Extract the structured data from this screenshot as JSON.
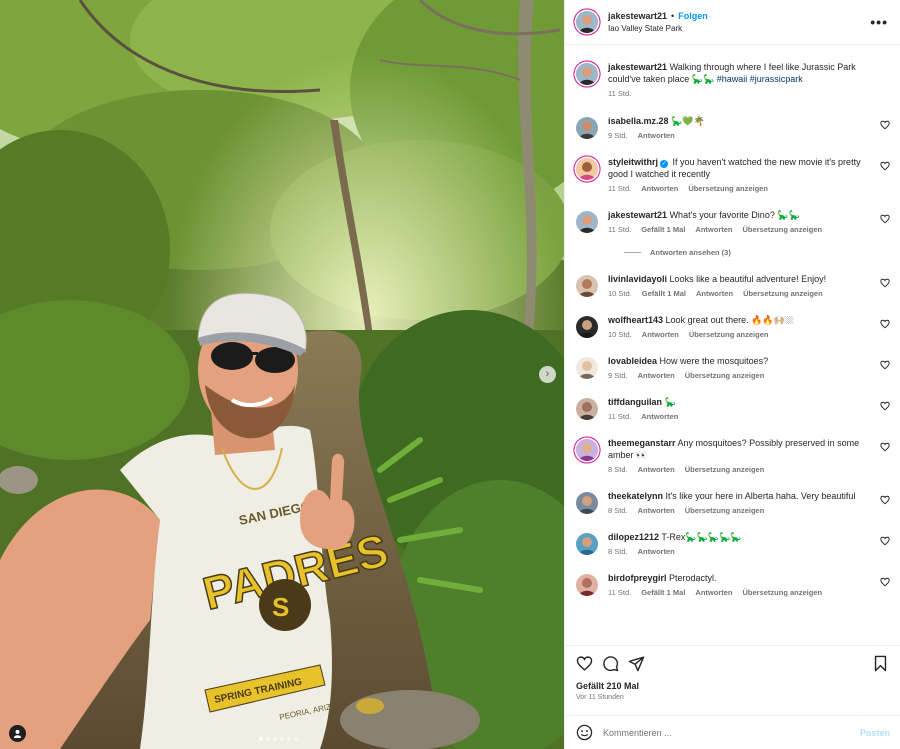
{
  "post": {
    "username": "jakestewart21",
    "separator": "•",
    "follow_label": "Folgen",
    "location": "Iao Valley State Park",
    "more_icon": "more-horizontal-icon"
  },
  "photo": {
    "print_top": "SAN DIEGO",
    "print_main": "PADRES",
    "print_banner": "SPRING TRAINING",
    "print_bottom": "PEORIA, ARIZ.",
    "slide_count": 6,
    "active_slide": 1
  },
  "caption": {
    "username": "jakestewart21",
    "text": "Walking through where I feel like Jurassic Park could've taken place 🦕🦕 ",
    "hashtags": "#hawaii #jurassicpark",
    "time": "11 Std."
  },
  "comments": [
    {
      "username": "isabella.mz.28",
      "verified": false,
      "text": "🦕💚🌴",
      "time": "9 Std.",
      "likes": "",
      "reply": "Antworten",
      "translate": ""
    },
    {
      "username": "styleitwithrj",
      "verified": true,
      "text": "If you haven't watched the new movie it's pretty good I watched it recently",
      "time": "11 Std.",
      "likes": "",
      "reply": "Antworten",
      "translate": "Übersetzung anzeigen"
    },
    {
      "username": "jakestewart21",
      "verified": false,
      "text": "What's your favorite Dino? 🦕🦕",
      "time": "11 Std.",
      "likes": "Gefällt 1 Mal",
      "reply": "Antworten",
      "translate": "Übersetzung anzeigen",
      "replies_label": "Antworten ansehen (3)"
    },
    {
      "username": "livinlavidayoli",
      "verified": false,
      "text": "Looks like a beautiful adventure! Enjoy!",
      "time": "10 Std.",
      "likes": "Gefällt 1 Mal",
      "reply": "Antworten",
      "translate": "Übersetzung anzeigen"
    },
    {
      "username": "wolfheart143",
      "verified": false,
      "text": "Look great out there. 🔥🔥🙌🏼🏼",
      "time": "10 Std.",
      "likes": "",
      "reply": "Antworten",
      "translate": "Übersetzung anzeigen"
    },
    {
      "username": "lovableidea",
      "verified": false,
      "text": "How were the mosquitoes?",
      "time": "9 Std.",
      "likes": "",
      "reply": "Antworten",
      "translate": "Übersetzung anzeigen"
    },
    {
      "username": "tiffdanguilan",
      "verified": false,
      "text": "🦕",
      "time": "11 Std.",
      "likes": "",
      "reply": "Antworten",
      "translate": ""
    },
    {
      "username": "theemeganstarr",
      "verified": false,
      "text": "Any mosquitoes? Possibly preserved in some amber 👀",
      "time": "8 Std.",
      "likes": "",
      "reply": "Antworten",
      "translate": "Übersetzung anzeigen"
    },
    {
      "username": "theekatelynn",
      "verified": false,
      "text": "It's like your here in Alberta haha. Very beautiful",
      "time": "8 Std.",
      "likes": "",
      "reply": "Antworten",
      "translate": "Übersetzung anzeigen"
    },
    {
      "username": "dilopez1212",
      "verified": false,
      "text": "T-Rex🦕🦕🦕🦕🦕",
      "time": "8 Std.",
      "likes": "",
      "reply": "Antworten",
      "translate": ""
    },
    {
      "username": "birdofpreygirl",
      "verified": false,
      "text": "Pterodactyl.",
      "time": "11 Std.",
      "likes": "Gefällt 1 Mal",
      "reply": "Antworten",
      "translate": "Übersetzung anzeigen"
    }
  ],
  "footer": {
    "likes": "Gefällt 210 Mal",
    "time_ago": "Vor 11 Stunden",
    "comment_placeholder": "Kommentieren ...",
    "post_label": "Posten"
  },
  "colors": {
    "accent": "#0095f6",
    "post_disabled": "#b2dffc",
    "muted_text": "#737373",
    "story_ring": "#d6249f"
  }
}
